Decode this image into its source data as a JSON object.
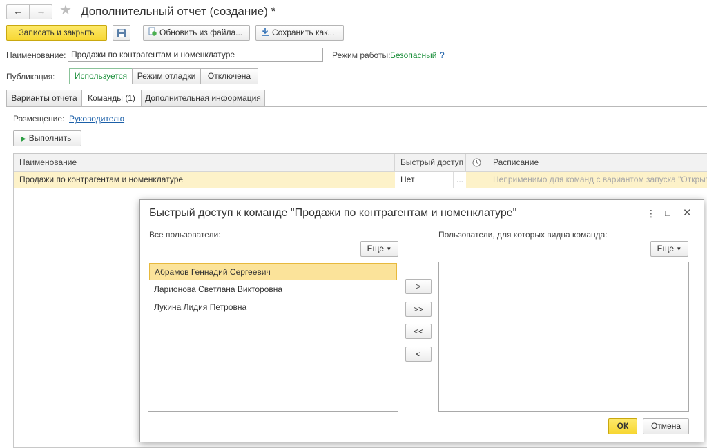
{
  "window": {
    "title": "Дополнительный отчет (создание) *",
    "nav_back": "←",
    "nav_forward": "→",
    "favorite_icon": "star-icon"
  },
  "toolbar": {
    "save_close": "Записать и закрыть",
    "update_from_file": "Обновить из файла...",
    "save_as": "Сохранить как..."
  },
  "form": {
    "name_label": "Наименование:",
    "name_value": "Продажи по контрагентам и номенклатуре",
    "mode_label": "Режим работы:",
    "mode_value": "Безопасный",
    "mode_help": "?",
    "publication_label": "Публикация:",
    "publication_options": [
      "Используется",
      "Режим отладки",
      "Отключена"
    ],
    "publication_selected": 0
  },
  "tabs": [
    {
      "label": "Варианты отчета",
      "active": false
    },
    {
      "label": "Команды (1)",
      "active": true
    },
    {
      "label": "Дополнительная информация",
      "active": false
    }
  ],
  "commands": {
    "placement_label": "Размещение:",
    "placement_value": "Руководителю",
    "run_button": "Выполнить",
    "table": {
      "columns": [
        "Наименование",
        "Быстрый доступ",
        "Расписание"
      ],
      "rows": [
        {
          "name": "Продажи по контрагентам и номенклатуре",
          "quick_access": "Нет",
          "ellipsis": "...",
          "schedule": "Неприменимо для команд с вариантом запуска \"Открыти"
        }
      ]
    }
  },
  "dialog": {
    "title": "Быстрый доступ к команде \"Продажи по контрагентам и номенклатуре\"",
    "menu_icon": "⋮",
    "maximize_icon": "□",
    "close_icon": "✕",
    "all_users_label": "Все пользователи:",
    "visible_users_label": "Пользователи, для которых видна команда:",
    "more_left": "Еще",
    "more_right": "Еще",
    "all_users": [
      "Абрамов Геннадий Сергеевич",
      "Ларионова Светлана Викторовна",
      "Лукина Лидия Петровна"
    ],
    "selected_index": 0,
    "visible_users": [],
    "move_buttons": [
      ">",
      ">>",
      "<<",
      "<"
    ],
    "ok": "ОК",
    "cancel": "Отмена"
  },
  "colors": {
    "accent_yellow": "#f7d733",
    "selection": "#fbe39a",
    "row_highlight": "#fdf2c9",
    "green_text": "#1a8f3a",
    "link_blue": "#1b5fa8"
  }
}
